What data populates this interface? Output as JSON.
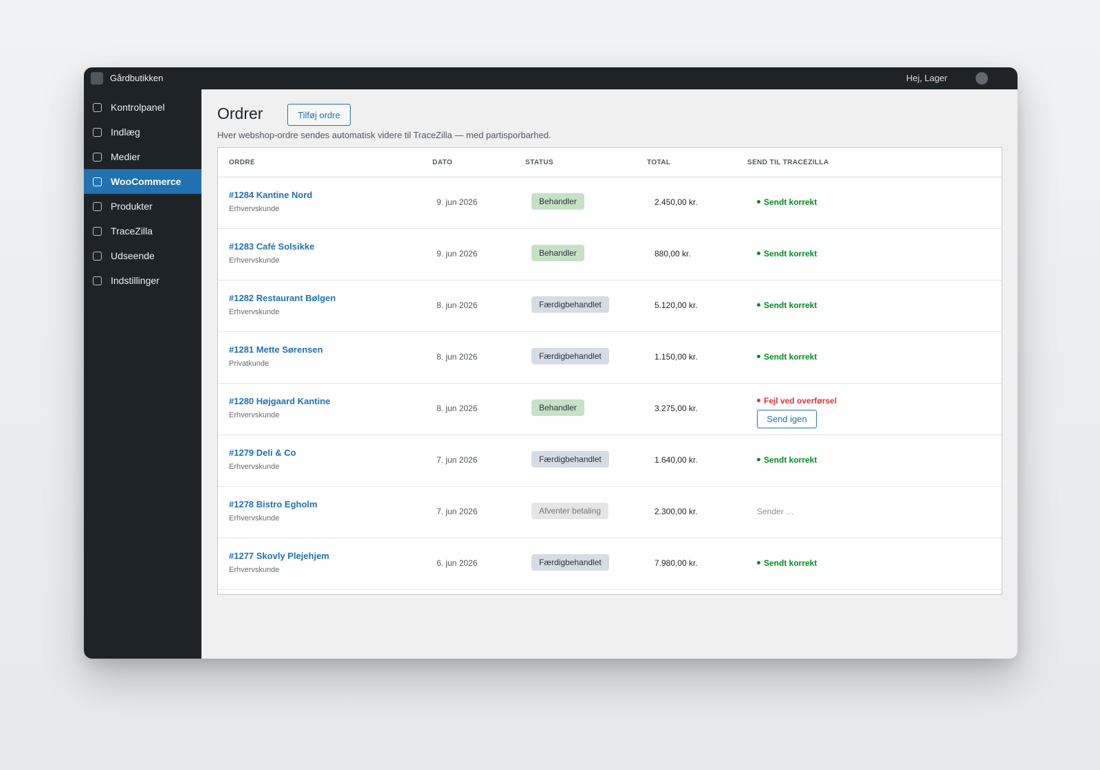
{
  "topbar": {
    "site_name": "Gårdbutikken",
    "greeting": "Hej, Lager"
  },
  "sidebar": {
    "items": [
      {
        "label": "Kontrolpanel"
      },
      {
        "label": "Indlæg"
      },
      {
        "label": "Medier"
      },
      {
        "label": "WooCommerce",
        "active": true
      },
      {
        "label": "Produkter"
      },
      {
        "label": "TraceZilla"
      },
      {
        "label": "Udseende"
      },
      {
        "label": "Indstillinger"
      }
    ]
  },
  "page": {
    "title": "Ordrer",
    "add_button": "Tilføj ordre",
    "subtitle": "Hver webshop-ordre sendes automatisk videre til TraceZilla — med partisporbarhed."
  },
  "table": {
    "columns": [
      "ORDRE",
      "DATO",
      "STATUS",
      "TOTAL",
      "SEND TIL TRACEZILLA"
    ],
    "rows": [
      {
        "order": "#1284 Kantine Nord",
        "type": "Erhvervskunde",
        "date": "9. jun 2026",
        "status": "Behandler",
        "status_kind": "processing",
        "total": "2.450,00 kr.",
        "send": "Sendt korrekt",
        "send_kind": "ok"
      },
      {
        "order": "#1283 Café Solsikke",
        "type": "Erhvervskunde",
        "date": "9. jun 2026",
        "status": "Behandler",
        "status_kind": "processing",
        "total": "880,00 kr.",
        "send": "Sendt korrekt",
        "send_kind": "ok"
      },
      {
        "order": "#1282 Restaurant Bølgen",
        "type": "Erhvervskunde",
        "date": "8. jun 2026",
        "status": "Færdigbehandlet",
        "status_kind": "completed",
        "total": "5.120,00 kr.",
        "send": "Sendt korrekt",
        "send_kind": "ok"
      },
      {
        "order": "#1281 Mette Sørensen",
        "type": "Privatkunde",
        "date": "8. jun 2026",
        "status": "Færdigbehandlet",
        "status_kind": "completed",
        "total": "1.150,00 kr.",
        "send": "Sendt korrekt",
        "send_kind": "ok"
      },
      {
        "order": "#1280 Højgaard Kantine",
        "type": "Erhvervskunde",
        "date": "8. jun 2026",
        "status": "Behandler",
        "status_kind": "processing",
        "total": "3.275,00 kr.",
        "send": "Fejl ved overførsel",
        "send_kind": "err",
        "retry_label": "Send igen"
      },
      {
        "order": "#1279 Deli & Co",
        "type": "Erhvervskunde",
        "date": "7. jun 2026",
        "status": "Færdigbehandlet",
        "status_kind": "completed",
        "total": "1.640,00 kr.",
        "send": "Sendt korrekt",
        "send_kind": "ok"
      },
      {
        "order": "#1278 Bistro Egholm",
        "type": "Erhvervskunde",
        "date": "7. jun 2026",
        "status": "Afventer betaling",
        "status_kind": "pending",
        "total": "2.300,00 kr.",
        "send": "Sender …",
        "send_kind": "pending"
      },
      {
        "order": "#1277 Skovly Plejehjem",
        "type": "Erhvervskunde",
        "date": "6. jun 2026",
        "status": "Færdigbehandlet",
        "status_kind": "completed",
        "total": "7.980,00 kr.",
        "send": "Sendt korrekt",
        "send_kind": "ok"
      }
    ]
  },
  "colors": {
    "accent": "#2271b1",
    "admin_bar": "#1d2327",
    "success": "#008a20",
    "error": "#d63638"
  }
}
